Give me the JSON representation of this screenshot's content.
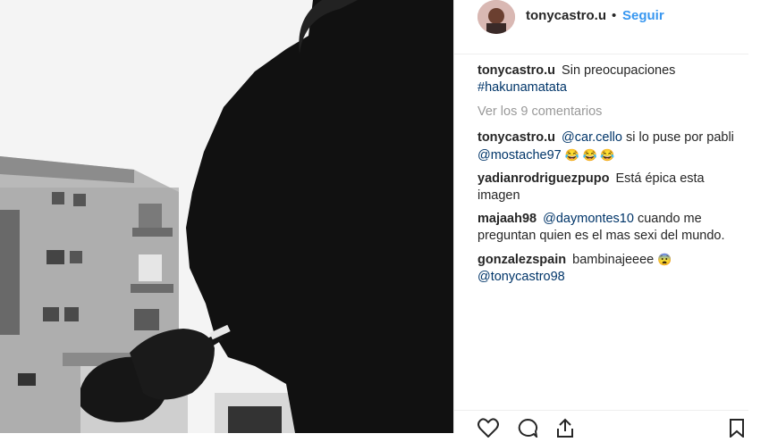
{
  "post": {
    "author": "tonycastro.u",
    "follow_label": "Seguir",
    "separator": "•"
  },
  "caption": {
    "username": "tonycastro.u",
    "text": "Sin preocupaciones",
    "hashtag": "#hakunamatata"
  },
  "view_comments": "Ver los 9 comentarios",
  "comments": [
    {
      "username": "tonycastro.u",
      "mention1": "@car.cello",
      "text1": "si lo puse por pabli",
      "mention2": "@mostache97",
      "emoji": "😂 😂 😂"
    },
    {
      "username": "yadianrodriguezpupo",
      "text": "Está épica esta imagen"
    },
    {
      "username": "majaah98",
      "mention": "@daymontes10",
      "text": "cuando me preguntan quien es el mas sexi del mundo."
    },
    {
      "username": "gonzalezspain",
      "text": "bambinajeeee",
      "emoji": "😨",
      "mention": "@tonycastro98"
    }
  ],
  "icons": {
    "like": "heart-icon",
    "comment": "comment-icon",
    "share": "share-icon",
    "save": "bookmark-icon"
  },
  "colors": {
    "link_blue": "#3897f0",
    "mention_blue": "#003569",
    "muted": "#999999",
    "text": "#262626"
  }
}
